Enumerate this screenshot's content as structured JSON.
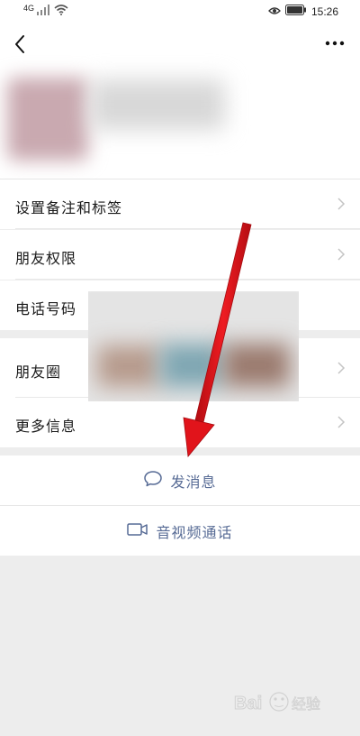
{
  "status_bar": {
    "network": "4G",
    "time": "15:26"
  },
  "nav": {
    "back_icon": "back-chevron-icon",
    "more_icon": "more-dots-icon"
  },
  "menu": {
    "items": [
      {
        "label": "设置备注和标签"
      },
      {
        "label": "朋友权限"
      },
      {
        "label": "电话号码"
      },
      {
        "label": "朋友圈"
      },
      {
        "label": "更多信息"
      }
    ]
  },
  "actions": {
    "send_message": "发消息",
    "video_call": "音视频通话"
  },
  "colors": {
    "accent": "#576b95",
    "arrow": "#e1141b",
    "background": "#ededed"
  },
  "watermark": {
    "text": "Baidu 经验"
  }
}
